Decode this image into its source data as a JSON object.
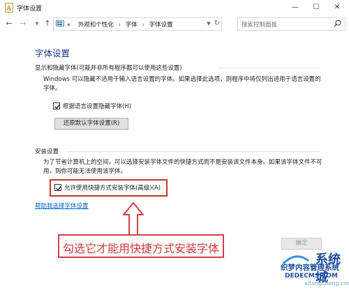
{
  "window": {
    "title": "字体设置",
    "minimize_glyph": "—",
    "maximize_glyph": "☐",
    "close_glyph": "✕"
  },
  "addressbar": {
    "overflow": "«",
    "crumbs": [
      "外观和个性化",
      "字体",
      "字体设置"
    ],
    "separator": "›",
    "search_placeholder": "搜索控制面板"
  },
  "page": {
    "title": "字体设置"
  },
  "section_hide": {
    "heading": "显示和隐藏字体(可能并非所有程序都可以使用这些设置)",
    "description": "Windows 可以隐藏不适用于输入语言设置的字体。如果选择此选项，则程序中将仅列出适用于语言设置的字体。",
    "checkbox_label": "根据语言设置隐藏字体(H)",
    "checkbox_checked": true,
    "restore_button": "还原默认字体设置(R)"
  },
  "section_install": {
    "heading": "安装设置",
    "description": "为了节省计算机上的空间，可以选择安装字体文件的快捷方式而不是安装该文件本身。如果该字体文件不可用，则你可能无法使用该字体。",
    "checkbox_label": "允许使用快捷方式安装字体(高级)(A)",
    "checkbox_checked": true
  },
  "help_link": "帮助我选择字体设置",
  "annotation": {
    "caption": "勾选它才能用快捷方式安装字体",
    "highlight_color": "#c0392b",
    "caption_color": "#d23a3a"
  },
  "ok_button": "确定",
  "watermark": {
    "big": "系统城",
    "line1": "织梦内容管理系统",
    "line2": "DEDECMS.COM",
    "line3": "xitongcheng.com"
  },
  "colors": {
    "title_blue": "#1e3287",
    "link_blue": "#0066cc"
  }
}
